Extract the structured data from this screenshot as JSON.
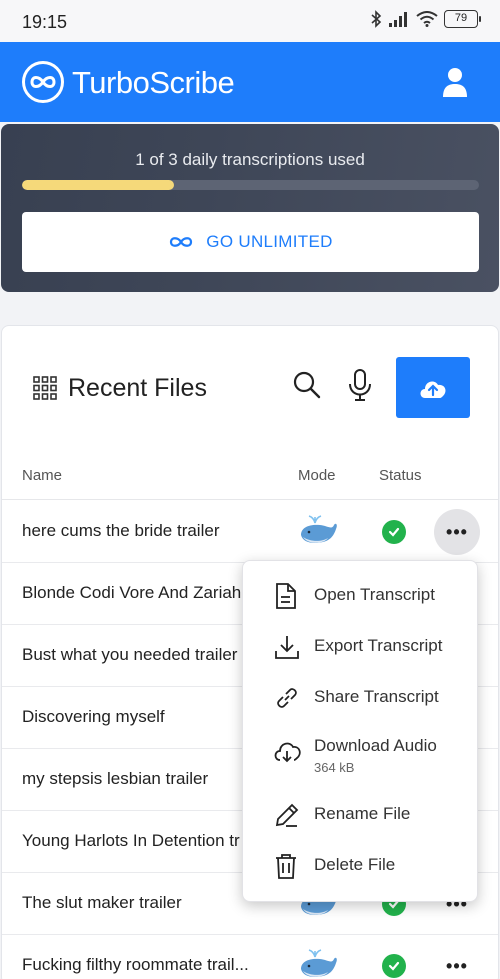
{
  "status_bar": {
    "time": "19:15",
    "battery": "79"
  },
  "app": {
    "brand": "TurboScribe"
  },
  "usage": {
    "text": "1 of 3 daily transcriptions used",
    "used": 1,
    "limit": 3,
    "button_label": "GO UNLIMITED"
  },
  "files": {
    "title": "Recent Files",
    "columns": {
      "name": "Name",
      "mode": "Mode",
      "status": "Status"
    },
    "rows": [
      {
        "name": "here cums the bride trailer"
      },
      {
        "name": "Blonde Codi Vore And Zariah"
      },
      {
        "name": "Bust what you needed trailer"
      },
      {
        "name": "Discovering myself"
      },
      {
        "name": "my stepsis lesbian trailer"
      },
      {
        "name": "Young Harlots In Detention tr"
      },
      {
        "name": "The slut maker trailer"
      },
      {
        "name": "Fucking filthy roommate trail..."
      }
    ]
  },
  "context_menu": {
    "open": "Open Transcript",
    "export": "Export Transcript",
    "share": "Share Transcript",
    "download": "Download Audio",
    "download_size": "364 kB",
    "rename": "Rename File",
    "delete": "Delete File"
  },
  "colors": {
    "brand_blue": "#1e7dfb",
    "progress_fill": "#f5d97a",
    "status_green": "#22b24c",
    "card_dark": "#3e4657"
  },
  "icons": {
    "logo": "infinity-icon",
    "user": "user-icon",
    "grid": "grid-icon",
    "search": "search-icon",
    "mic": "microphone-icon",
    "upload": "cloud-upload-icon",
    "mode": "whale-icon",
    "status": "check-icon",
    "more": "more-horizontal-icon"
  }
}
